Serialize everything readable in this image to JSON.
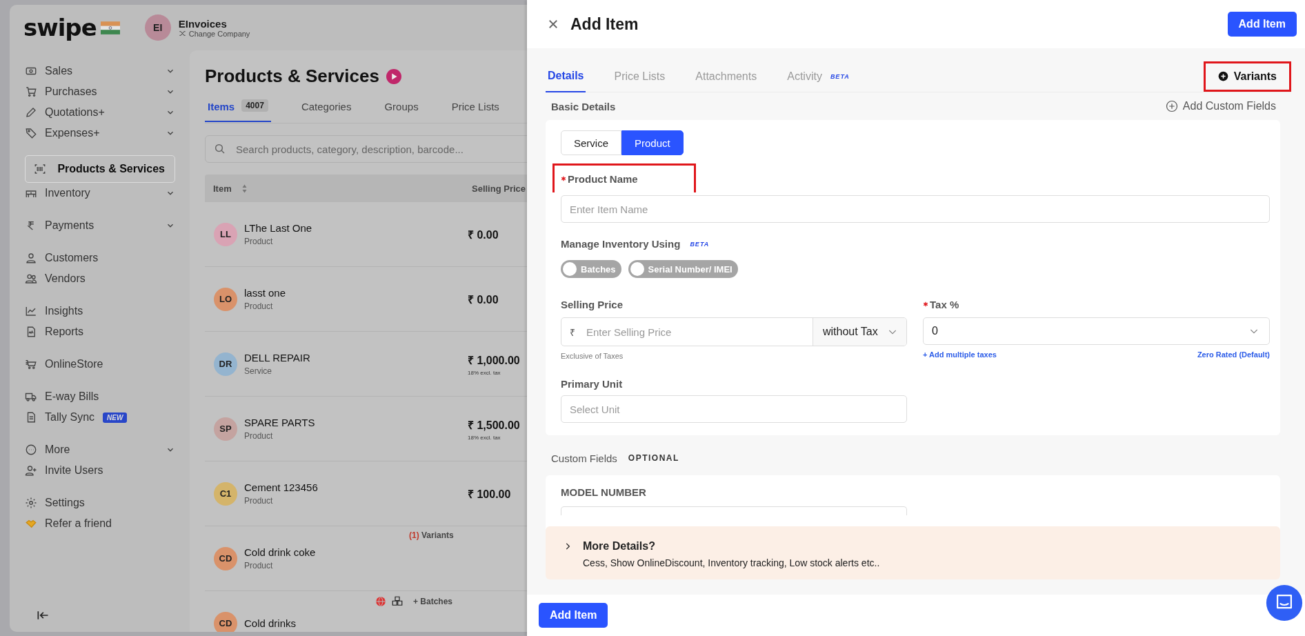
{
  "header": {
    "logo": "swipe",
    "company_initials": "EI",
    "company_name": "EInvoices",
    "company_action": "Change Company"
  },
  "sidebar": {
    "groups": [
      {
        "items": [
          {
            "label": "Sales",
            "expandable": true,
            "selected": false
          },
          {
            "label": "Purchases",
            "expandable": true,
            "selected": false
          },
          {
            "label": "Quotations+",
            "expandable": true,
            "selected": false
          },
          {
            "label": "Expenses+",
            "expandable": true,
            "selected": false
          }
        ]
      },
      {
        "items": [
          {
            "label": "Products & Services",
            "expandable": false,
            "selected": true
          },
          {
            "label": "Inventory",
            "expandable": true,
            "selected": false
          }
        ]
      },
      {
        "items": [
          {
            "label": "Payments",
            "expandable": true,
            "selected": false
          }
        ]
      },
      {
        "items": [
          {
            "label": "Customers",
            "expandable": false,
            "selected": false
          },
          {
            "label": "Vendors",
            "expandable": false,
            "selected": false
          }
        ]
      },
      {
        "items": [
          {
            "label": "Insights",
            "expandable": false,
            "selected": false
          },
          {
            "label": "Reports",
            "expandable": false,
            "selected": false
          }
        ]
      },
      {
        "items": [
          {
            "label": "OnlineStore",
            "expandable": false,
            "selected": false
          }
        ]
      },
      {
        "items": [
          {
            "label": "E-way Bills",
            "expandable": false,
            "selected": false
          },
          {
            "label": "Tally Sync",
            "expandable": false,
            "selected": false,
            "badge": "NEW"
          }
        ]
      },
      {
        "items": [
          {
            "label": "More",
            "expandable": true,
            "selected": false
          },
          {
            "label": "Invite Users",
            "expandable": false,
            "selected": false
          }
        ]
      },
      {
        "items": [
          {
            "label": "Settings",
            "expandable": false,
            "selected": false
          },
          {
            "label": "Refer a friend",
            "expandable": false,
            "selected": false
          }
        ]
      }
    ]
  },
  "page": {
    "title": "Products & Services",
    "tabs": [
      {
        "label": "Items",
        "count": "4007",
        "selected": true
      },
      {
        "label": "Categories",
        "selected": false
      },
      {
        "label": "Groups",
        "selected": false
      },
      {
        "label": "Price Lists",
        "selected": false
      }
    ],
    "search": {
      "placeholder": "Search products, category, description, barcode..."
    },
    "columns": [
      "Item",
      "Selling Price"
    ],
    "rows": [
      {
        "initials": "LL",
        "color": "#d9a3b4",
        "name": "LThe Last One",
        "type": "Product",
        "price": "₹ 0.00"
      },
      {
        "initials": "LO",
        "color": "#d9926a",
        "name": "lasst one",
        "type": "Product",
        "price": "₹ 0.00"
      },
      {
        "initials": "DR",
        "color": "#94b4cf",
        "name": "DELL REPAIR",
        "type": "Service",
        "price": "₹ 1,000.00",
        "tax_note": "18% excl. tax"
      },
      {
        "initials": "SP",
        "color": "#c4a3a0",
        "name": "SPARE PARTS",
        "type": "Product",
        "price": "₹ 1,500.00",
        "tax_note": "18% excl. tax"
      },
      {
        "initials": "C1",
        "color": "#d4b46a",
        "name": "Cement 123456",
        "type": "Product",
        "price": "₹ 100.00"
      },
      {
        "initials": "CD",
        "color": "#d9926a",
        "name": "Cold drink coke",
        "type": "Product",
        "variants_count": "(1)",
        "variants_label": "Variants"
      },
      {
        "initials": "CD",
        "color": "#d9926a",
        "name": "Cold drinks",
        "batches": "+ Batches"
      }
    ]
  },
  "drawer": {
    "title": "Add Item",
    "top_button": "Add Item",
    "tabs": [
      {
        "label": "Details",
        "selected": true
      },
      {
        "label": "Price Lists",
        "selected": false
      },
      {
        "label": "Attachments",
        "selected": false
      },
      {
        "label": "Activity",
        "selected": false,
        "badge": "BETA"
      }
    ],
    "variants_button": {
      "label": "Variants",
      "highlighted": true
    },
    "section_title": "Basic Details",
    "custom_fields_link": "Add Custom Fields",
    "type_options": [
      {
        "label": "Service",
        "selected": false
      },
      {
        "label": "Product",
        "selected": true
      }
    ],
    "product_name": {
      "label": "Product Name",
      "required": true,
      "placeholder": "Enter Item Name",
      "highlighted": true
    },
    "inventory": {
      "label": "Manage Inventory Using",
      "badge": "BETA",
      "toggles": [
        {
          "label": "Batches",
          "on": false
        },
        {
          "label": "Serial Number/ IMEI",
          "on": false
        }
      ]
    },
    "selling_price": {
      "label": "Selling Price",
      "currency": "₹",
      "placeholder": "Enter Selling Price",
      "tax_mode": "without Tax",
      "hint": "Exclusive of Taxes"
    },
    "tax": {
      "label": "Tax %",
      "required": true,
      "value": "0",
      "link": "+ Add multiple taxes",
      "note": "Zero Rated (Default)"
    },
    "primary_unit": {
      "label": "Primary Unit",
      "placeholder": "Select Unit"
    },
    "custom_fields": {
      "title": "Custom Fields",
      "badge": "OPTIONAL",
      "fields": [
        "MODEL NUMBER"
      ]
    },
    "more_details": {
      "title": "More Details?",
      "text": "Cess, Show OnlineDiscount, Inventory tracking, Low stock alerts etc.."
    },
    "footer_button": "Add Item"
  }
}
